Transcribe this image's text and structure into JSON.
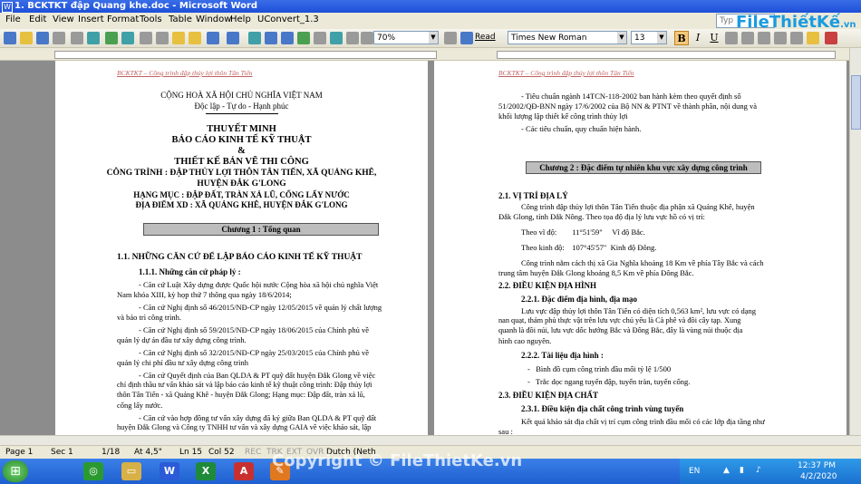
{
  "window": {
    "title": "1. BCKTKT đập Quang khe.doc - Microsoft Word"
  },
  "menu": [
    "File",
    "Edit",
    "View",
    "Insert",
    "Format",
    "Tools",
    "Table",
    "Window",
    "Help",
    "UConvert_1.3"
  ],
  "help_box": {
    "placeholder": "Typ"
  },
  "logo": {
    "text": "FileThiếtKế",
    "suffix": ".vn"
  },
  "toolbar": {
    "zoom": "70%",
    "read_label": "Read",
    "font": "Times New Roman",
    "size": "13",
    "bold": "B",
    "italic": "I",
    "underline": "U"
  },
  "page1": {
    "header": "BCKTKT – Công trình đập thủy lợi thôn Tân Tiến",
    "nation": "CỘNG HOÀ XÃ HỘI CHỦ NGHĨA VIỆT NAM",
    "motto": "Độc lập - Tự do - Hạnh phúc",
    "t1": "THUYẾT MINH",
    "t2": "BÁO CÁO KINH TẾ KỸ THUẬT",
    "t3": "&",
    "t4": "THIẾT KẾ BẢN VẼ THI CÔNG",
    "t5": "CÔNG TRÌNH : ĐẬP THỦY LỢI THÔN TÂN TIẾN, XÃ QUẢNG KHÊ,",
    "t6": "HUYỆN ĐẮK G'LONG",
    "t7": "HẠNG MỤC : ĐẬP ĐẤT, TRÀN XẢ LŨ, CỐNG LẤY NƯỚC",
    "t8": "ĐỊA ĐIỂM XD : XÃ QUẢNG KHÊ, HUYỆN ĐẮK G'LONG",
    "chapter": "Chương 1 : Tổng quan",
    "s1": "1.1. NHỮNG CĂN CỨ ĐỂ LẬP BÁO CÁO KINH TẾ KỸ THUẬT",
    "s11": "1.1.1. Những căn cứ pháp lý :",
    "lines": [
      "- Căn cứ Luật Xây dựng được Quốc hội nước Cộng hòa xã hội chủ nghĩa Việt",
      "Nam khóa XIII, kỳ họp thứ 7 thông qua ngày 18/6/2014;",
      "- Căn cứ Nghị định số 46/2015/NĐ-CP ngày 12/05/2015 về quản lý chất lượng",
      "và bảo trì công trình.",
      "- Căn cứ Nghị định số 59/2015/NĐ-CP ngày 18/06/2015 của Chính phủ về",
      "quản lý dự án đầu tư xây dựng công trình.",
      "- Căn cứ Nghị định số 32/2015/NĐ-CP ngày 25/03/2015 của Chính phủ về",
      "quản lý chi phí đầu tư xây dựng công trình",
      "- Căn cứ Quyết định của Ban QLDA & PT quỹ đất huyện Đắk Glong về việc",
      "chỉ định thầu tư vấn khảo sát và lập báo cáo kinh tế kỹ thuật công trình: Đập thủy lợi",
      "thôn Tân Tiến - xã Quảng Khê - huyện Đắk Glong; Hạng mục: Đập đất, tràn xả lũ,",
      "cống lấy nước.",
      "- Căn cứ vào hợp đồng tư vấn xây dựng đã ký giữa Ban QLDA & PT quỹ đất",
      "huyện Đắk Glong và Công ty TNHH tư vấn và xây dựng GAIA về việc khảo sát, lập"
    ]
  },
  "page2": {
    "header": "BCKTKT – Công trình đập thủy lợi thôn Tân Tiến",
    "p1": "- Tiêu chuẩn ngành 14TCN-118-2002 ban hành kèm theo quyết định số",
    "p1b": "51/2002/QĐ-BNN ngày 17/6/2002 của Bộ NN & PTNT về thành phần, nội dung và",
    "p1c": "khối lượng lập thiết kế công trình thủy lợi",
    "p2": "- Các tiêu chuẩn, quy chuẩn hiện hành.",
    "chapter": "Chương 2 : Đặc điểm tự nhiên khu vực xây dựng công trình",
    "s21": "2.1. VỊ TRÍ ĐỊA LÝ",
    "l1": "Công trình đập thủy lợi thôn Tân Tiến thuộc địa phận xã Quảng Khê, huyện",
    "l2": "Đắk Glong, tỉnh Đắk Nông. Theo tọa độ địa lý lưu vực hồ có vị trí:",
    "l3": "Theo vĩ độ:        11°51'59\"     Vĩ độ Bắc.",
    "l4": "Theo kinh độ:    107°45'57\"  Kinh độ Đông.",
    "l5": "Công trình nằm cách thị xã Gia Nghĩa khoảng 18 Km về phía Tây Bắc và cách",
    "l6": "trung tâm huyện Đắk Glong khoảng 8,5 Km về phía Đông Bắc.",
    "s22": "2.2. ĐIỀU KIỆN ĐỊA HÌNH",
    "s221": "2.2.1. Đặc điểm địa hình, địa mạo",
    "l7": "Lưu vực đập thủy lợi thôn Tân Tiến có diện tích 0,563 km², lưu vực có dạng",
    "l8": "nan quạt, thảm phủ thực vật trên lưu vực chủ yếu là Cà phê và đồi cây tạp. Xung",
    "l9": "quanh là đồi núi, lưu vực dốc hướng Bắc và Đông Bắc, đây là vùng núi thuộc địa",
    "l10": "hình cao nguyên.",
    "s222": "2.2.2. Tài liệu địa hình :",
    "l11": "-   Bình đồ cụm công trình đầu mối tỷ lệ 1/500",
    "l12": "-   Trắc dọc ngang tuyến đập, tuyến tràn, tuyến cống.",
    "s23": "2.3. ĐIỀU KIỆN ĐỊA CHẤT",
    "s231": "2.3.1. Điều kiện địa chất công trình vùng tuyến",
    "l13": "Kết quả khảo sát địa chất vị trí cụm công trình đầu mối có các lớp địa tầng như",
    "l14": "sau :"
  },
  "status": {
    "page": "Page 1",
    "sec": "Sec 1",
    "count": "1/18",
    "at": "At 4,5\"",
    "ln": "Ln 15",
    "col": "Col 52",
    "rec": "REC",
    "trk": "TRK",
    "ext": "EXT",
    "ovr": "OVR",
    "lang": "Dutch (Neth"
  },
  "watermark": "Copyright © FileThietKe.vn",
  "tray": {
    "lang": "EN",
    "time": "12:37 PM",
    "date": "4/2/2020"
  }
}
